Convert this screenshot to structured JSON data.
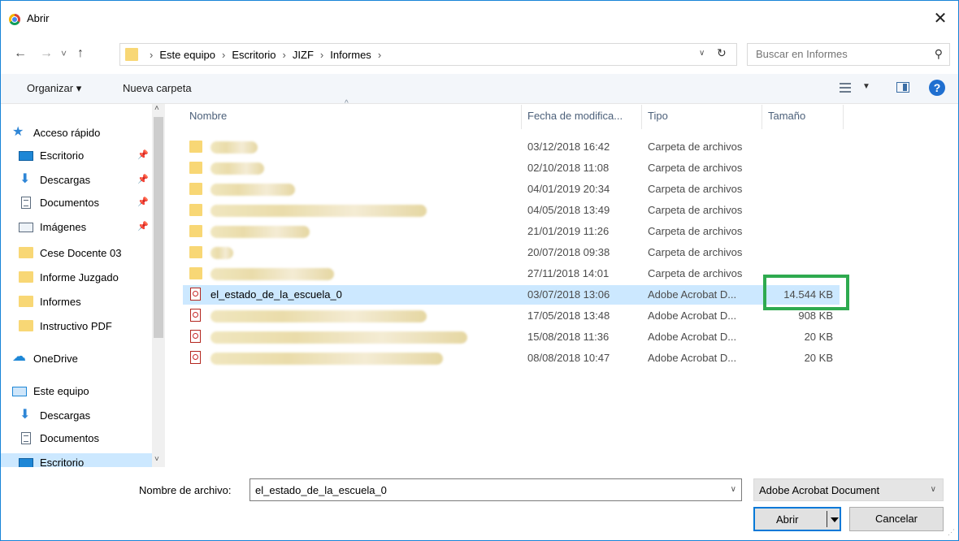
{
  "window": {
    "title": "Abrir",
    "close_glyph": "✕"
  },
  "nav": {
    "back": "←",
    "forward": "→",
    "history": "˅",
    "up": "↑",
    "breadcrumb": [
      "Este equipo",
      "Escritorio",
      "JIZF",
      "Informes"
    ],
    "separator": "›",
    "dropdown_glyph": "∨",
    "refresh_glyph": "↻",
    "search_placeholder": "Buscar en Informes",
    "search_glyph": "⚲"
  },
  "toolbar": {
    "organize": "Organizar ▾",
    "new_folder": "Nueva carpeta",
    "help": "?",
    "view_dropdown": "▼"
  },
  "sidebar": {
    "quick_access": "Acceso rápido",
    "items": [
      {
        "label": "Escritorio",
        "pinned": true
      },
      {
        "label": "Descargas",
        "pinned": true
      },
      {
        "label": "Documentos",
        "pinned": true
      },
      {
        "label": "Imágenes",
        "pinned": true
      },
      {
        "label": "Cese Docente 03",
        "pinned": false
      },
      {
        "label": "Informe Juzgado",
        "pinned": false
      },
      {
        "label": "Informes",
        "pinned": false
      },
      {
        "label": "Instructivo PDF",
        "pinned": false
      }
    ],
    "onedrive": "OneDrive",
    "this_pc": "Este equipo",
    "pc_items": [
      "Descargas",
      "Documentos",
      "Escritorio"
    ],
    "pin_glyph": "📌",
    "scroll_up": "˄",
    "scroll_down": "˅"
  },
  "columns": {
    "name": "Nombre",
    "date": "Fecha de modifica...",
    "type": "Tipo",
    "size": "Tamaño",
    "sort_glyph": "^"
  },
  "files": [
    {
      "name": "",
      "date": "03/12/2018 16:42",
      "type": "Carpeta de archivos",
      "size": "",
      "kind": "folder",
      "redacted": true
    },
    {
      "name": "",
      "date": "02/10/2018 11:08",
      "type": "Carpeta de archivos",
      "size": "",
      "kind": "folder",
      "redacted": true
    },
    {
      "name": "",
      "date": "04/01/2019 20:34",
      "type": "Carpeta de archivos",
      "size": "",
      "kind": "folder",
      "redacted": true
    },
    {
      "name": "",
      "date": "04/05/2018 13:49",
      "type": "Carpeta de archivos",
      "size": "",
      "kind": "folder",
      "redacted": true
    },
    {
      "name": "",
      "date": "21/01/2019 11:26",
      "type": "Carpeta de archivos",
      "size": "",
      "kind": "folder",
      "redacted": true
    },
    {
      "name": "",
      "date": "20/07/2018 09:38",
      "type": "Carpeta de archivos",
      "size": "",
      "kind": "folder",
      "redacted": true
    },
    {
      "name": "",
      "date": "27/11/2018 14:01",
      "type": "Carpeta de archivos",
      "size": "",
      "kind": "folder",
      "redacted": true
    },
    {
      "name": "el_estado_de_la_escuela_0",
      "date": "03/07/2018 13:06",
      "type": "Adobe Acrobat D...",
      "size": "14.544 KB",
      "kind": "pdf",
      "redacted": false,
      "selected": true
    },
    {
      "name": "",
      "date": "17/05/2018 13:48",
      "type": "Adobe Acrobat D...",
      "size": "908 KB",
      "kind": "pdf",
      "redacted": true
    },
    {
      "name": "",
      "date": "15/08/2018 11:36",
      "type": "Adobe Acrobat D...",
      "size": "20 KB",
      "kind": "pdf",
      "redacted": true
    },
    {
      "name": "",
      "date": "08/08/2018 10:47",
      "type": "Adobe Acrobat D...",
      "size": "20 KB",
      "kind": "pdf",
      "redacted": true
    }
  ],
  "footer": {
    "filename_label": "Nombre de archivo:",
    "filename_value": "el_estado_de_la_escuela_0",
    "filter_value": "Adobe Acrobat Document",
    "dropdown_glyph": "∨",
    "open_button": "Abrir",
    "cancel_button": "Cancelar",
    "grip": "⋰"
  },
  "colors": {
    "accent": "#0078d7",
    "selection": "#cce8ff",
    "highlight_box": "#2eaa4f",
    "folder": "#f8d775"
  }
}
